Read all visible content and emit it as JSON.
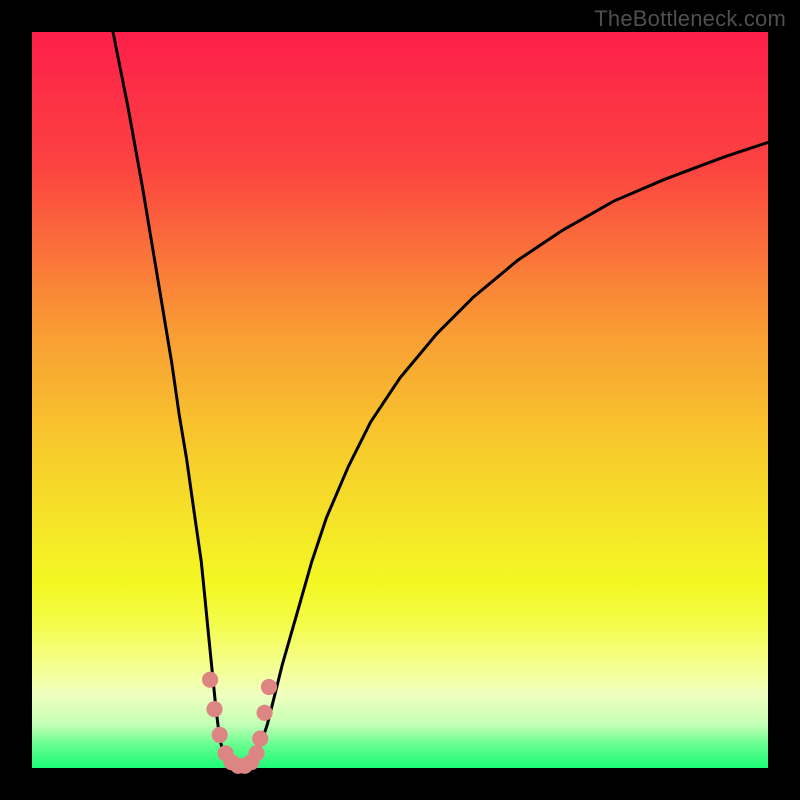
{
  "watermark": "TheBottleneck.com",
  "colors": {
    "frame": "#000000",
    "gradient_stops": [
      {
        "pct": 0,
        "color": "#fd1f4a"
      },
      {
        "pct": 18,
        "color": "#fc4241"
      },
      {
        "pct": 40,
        "color": "#f99a34"
      },
      {
        "pct": 58,
        "color": "#f7cf2b"
      },
      {
        "pct": 75,
        "color": "#f3f823"
      },
      {
        "pct": 80,
        "color": "#f4fc46"
      },
      {
        "pct": 86,
        "color": "#f4ff8e"
      },
      {
        "pct": 90,
        "color": "#f0ffbf"
      },
      {
        "pct": 94,
        "color": "#c5ffb7"
      },
      {
        "pct": 97,
        "color": "#63fd8d"
      },
      {
        "pct": 100,
        "color": "#1bfc78"
      }
    ],
    "curve": "#000000",
    "marker": "#dd8582"
  },
  "chart_data": {
    "type": "line",
    "title": "",
    "xlabel": "",
    "ylabel": "",
    "xlim": [
      0,
      100
    ],
    "ylim": [
      0,
      100
    ],
    "legend": false,
    "grid": false,
    "series": [
      {
        "name": "left-branch",
        "x": [
          11,
          13,
          15,
          17,
          19,
          20,
          21,
          22,
          23,
          23.5,
          24,
          24.5,
          25,
          25.5,
          26,
          27,
          28
        ],
        "y": [
          100,
          90,
          79,
          67,
          55,
          48,
          42,
          35,
          28,
          23,
          18,
          13,
          8,
          4,
          2,
          0.5,
          0
        ]
      },
      {
        "name": "right-branch",
        "x": [
          28,
          29,
          30,
          31,
          32,
          33,
          34,
          36,
          38,
          40,
          43,
          46,
          50,
          55,
          60,
          66,
          72,
          79,
          86,
          94,
          100
        ],
        "y": [
          0,
          0.2,
          1,
          3,
          6,
          10,
          14,
          21,
          28,
          34,
          41,
          47,
          53,
          59,
          64,
          69,
          73,
          77,
          80,
          83,
          85
        ]
      }
    ],
    "markers_x": [
      24.2,
      24.8,
      25.5,
      26.3,
      27.1,
      28.0,
      28.9,
      29.8,
      30.5,
      31.0,
      31.6,
      32.2
    ],
    "markers_y": [
      12.0,
      8.0,
      4.5,
      2.0,
      0.8,
      0.3,
      0.3,
      0.8,
      2.0,
      4.0,
      7.5,
      11.0
    ],
    "marker_radius_pct": 1.1
  }
}
